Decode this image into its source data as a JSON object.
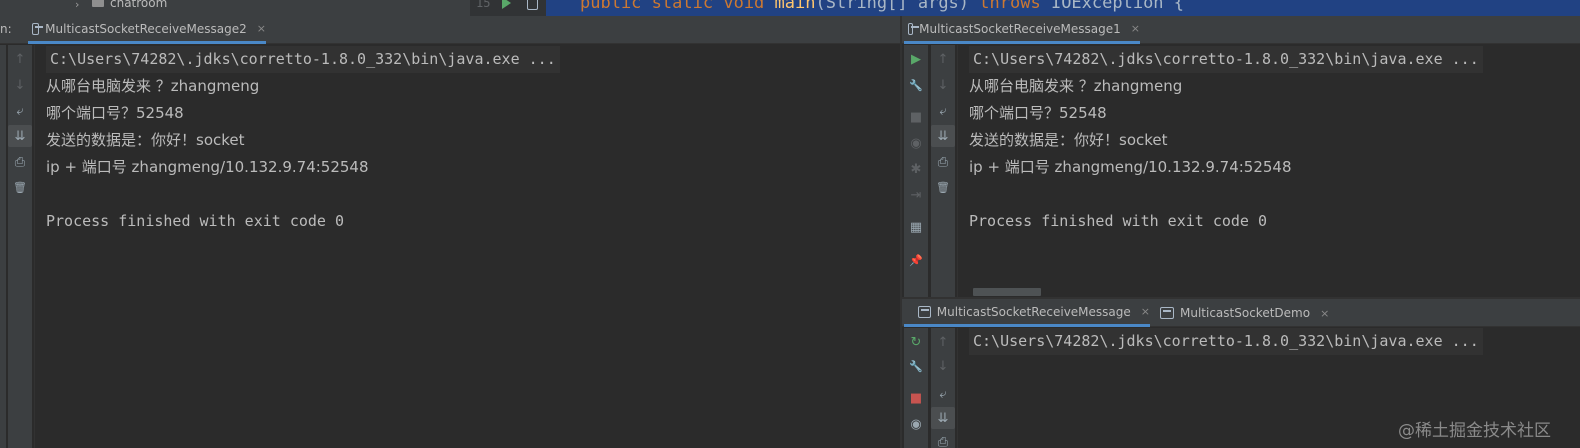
{
  "top": {
    "tree_label": "chatroom",
    "line_number": "15",
    "code_public": "public",
    "code_static": "static",
    "code_void": "void",
    "code_main": "main",
    "code_args": "(String[] args)",
    "code_throws": "throws",
    "code_exception": "IOException {"
  },
  "left_panel": {
    "label": "n:",
    "tab_label": "MulticastSocketReceiveMessage2",
    "tab_close": "×",
    "console": {
      "command": "C:\\Users\\74282\\.jdks\\corretto-1.8.0_332\\bin\\java.exe ...",
      "lines": [
        "从哪台电脑发来 ？zhangmeng",
        "哪个端口号？52548",
        "发送的数据是：你好！socket",
        "ip + 端口号 zhangmeng/10.132.9.74:52548",
        "",
        "Process finished with exit code 0"
      ]
    }
  },
  "right_top_panel": {
    "tab_label": "MulticastSocketReceiveMessage1",
    "tab_close": "×",
    "console": {
      "command": "C:\\Users\\74282\\.jdks\\corretto-1.8.0_332\\bin\\java.exe ...",
      "lines": [
        "从哪台电脑发来 ？zhangmeng",
        "哪个端口号？52548",
        "发送的数据是：你好！socket",
        "ip + 端口号 zhangmeng/10.132.9.74:52548",
        "",
        "Process finished with exit code 0"
      ]
    }
  },
  "right_bottom_panel": {
    "tabs": [
      {
        "label": "MulticastSocketReceiveMessage",
        "close": "×"
      },
      {
        "label": "MulticastSocketDemo",
        "close": "×"
      }
    ],
    "console": {
      "command": "C:\\Users\\74282\\.jdks\\corretto-1.8.0_332\\bin\\java.exe ..."
    }
  },
  "icons": {
    "up": "↑",
    "down": "↓",
    "wrap": "⤶",
    "scroll_end": "⇊",
    "print": "⎙",
    "trash": "🗑",
    "run": "▶",
    "rerun": "↻",
    "wrench": "🔧",
    "stop": "■",
    "camera": "◉",
    "bug": "✱",
    "exit": "⇥",
    "layout": "▦",
    "pin": "📌"
  },
  "colors": {
    "background": "#2b2b2b",
    "toolbar": "#3c3f41",
    "accent_tab": "#4a88c7",
    "editor_selection": "#214283",
    "run_green": "#59a869",
    "stop_red": "#c75450"
  },
  "watermark": "@稀土掘金技术社区"
}
